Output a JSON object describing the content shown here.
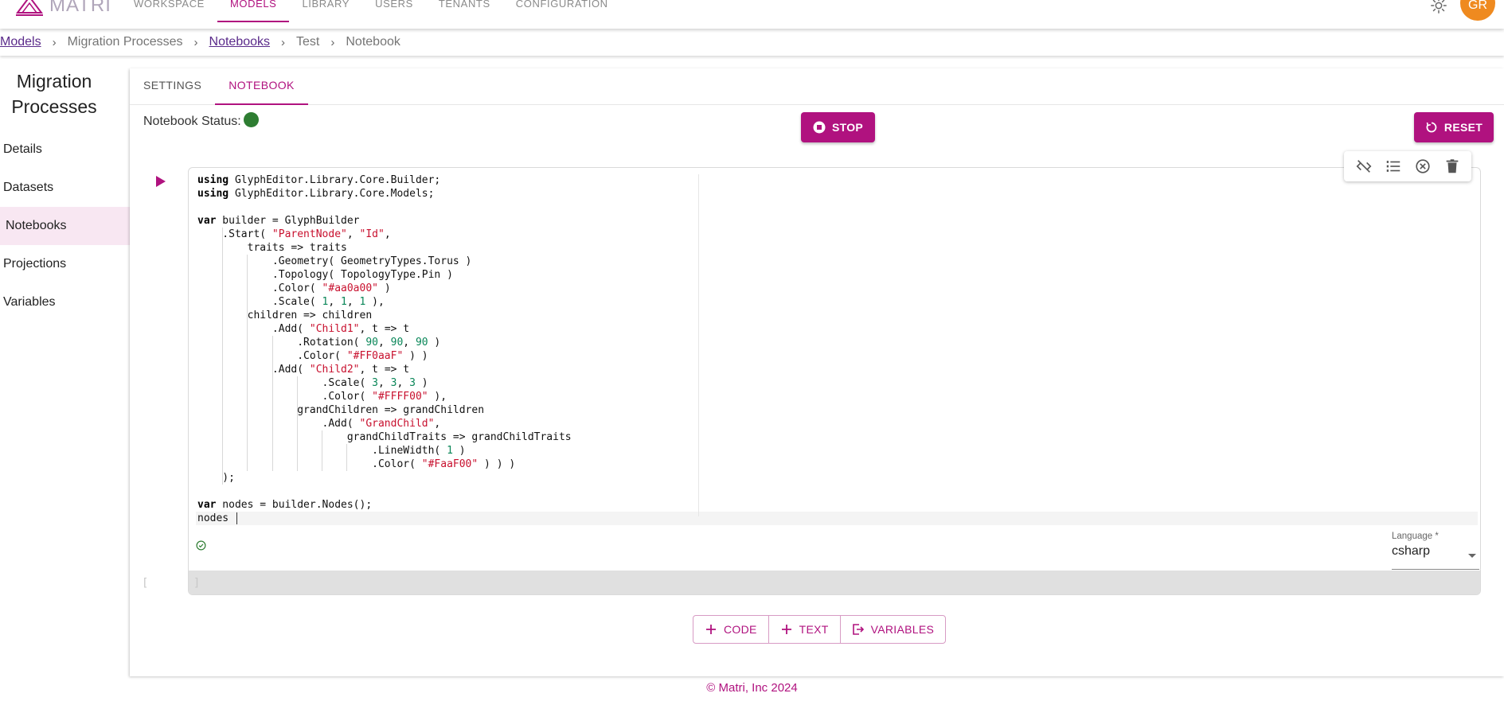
{
  "app": {
    "name": "MATRI"
  },
  "nav": {
    "items": [
      {
        "label": "WORKSPACE",
        "active": false
      },
      {
        "label": "MODELS",
        "active": true
      },
      {
        "label": "LIBRARY",
        "active": false
      },
      {
        "label": "USERS",
        "active": false
      },
      {
        "label": "TENANTS",
        "active": false
      },
      {
        "label": "CONFIGURATION",
        "active": false
      }
    ]
  },
  "user": {
    "initials": "GR",
    "avatar_color": "#ef8a1f"
  },
  "breadcrumb": [
    {
      "label": "Models",
      "link": true
    },
    {
      "label": "Migration Processes",
      "link": false
    },
    {
      "label": "Notebooks",
      "link": true
    },
    {
      "label": "Test",
      "link": false
    },
    {
      "label": "Notebook",
      "link": false
    }
  ],
  "sidebar": {
    "title_line1": "Migration",
    "title_line2": "Processes",
    "items": [
      {
        "label": "Details",
        "active": false
      },
      {
        "label": "Datasets",
        "active": false
      },
      {
        "label": "Notebooks",
        "active": true
      },
      {
        "label": "Projections",
        "active": false
      },
      {
        "label": "Variables",
        "active": false
      }
    ]
  },
  "tabs": [
    {
      "label": "SETTINGS",
      "active": false
    },
    {
      "label": "NOTEBOOK",
      "active": true
    }
  ],
  "notebook": {
    "status_label": "Notebook Status:",
    "status_color": "#2e7d32",
    "stop_label": "STOP",
    "reset_label": "RESET"
  },
  "cell": {
    "code_lines": [
      "using GlyphEditor.Library.Core.Builder;",
      "using GlyphEditor.Library.Core.Models;",
      "",
      "var builder = GlyphBuilder",
      "    .Start( \"ParentNode\", \"Id\",",
      "        traits => traits",
      "            .Geometry( GeometryTypes.Torus )",
      "            .Topology( TopologyType.Pin )",
      "            .Color( \"#aa0a00\" )",
      "            .Scale( 1, 1, 1 ),",
      "        children => children",
      "            .Add( \"Child1\", t => t",
      "                .Rotation( 90, 90, 90 )",
      "                .Color( \"#FF0aaF\" ) )",
      "            .Add( \"Child2\", t => t",
      "                    .Scale( 3, 3, 3 )",
      "                    .Color( \"#FFFF00\" ),",
      "                grandChildren => grandChildren",
      "                    .Add( \"GrandChild\",",
      "                        grandChildTraits => grandChildTraits",
      "                            .LineWidth( 1 )",
      "                            .Color( \"#FaaF00\" ) ) )",
      "    );",
      "",
      "var nodes = builder.Nodes();",
      "nodes "
    ],
    "language_label": "Language *",
    "language_value": "csharp",
    "exec_count": "[ ]"
  },
  "add_buttons": {
    "code": "CODE",
    "text": "TEXT",
    "variables": "VARIABLES"
  },
  "footer": {
    "text": "© Matri, Inc 2024"
  },
  "colors": {
    "accent": "#b0127f",
    "active_side_bg": "#f8e7f2",
    "string": "#c8102e",
    "number": "#098658"
  }
}
